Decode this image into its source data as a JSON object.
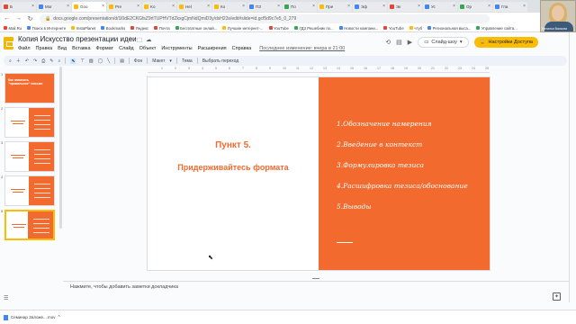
{
  "browser": {
    "tabs": [
      {
        "label": "Б",
        "color": "red",
        "active": false
      },
      {
        "label": "Mor",
        "color": "blue",
        "active": false
      },
      {
        "label": "Goo",
        "color": "yellow",
        "active": true
      },
      {
        "label": "Pre",
        "color": "yellow",
        "active": false
      },
      {
        "label": "Ko",
        "color": "yellow",
        "active": false
      },
      {
        "label": "Hel",
        "color": "yellow",
        "active": false
      },
      {
        "label": "Ко",
        "color": "yellow",
        "active": false
      },
      {
        "label": "ПЗ",
        "color": "blue",
        "active": false
      },
      {
        "label": "По",
        "color": "green",
        "active": false
      },
      {
        "label": "Пре",
        "color": "yellow",
        "active": false
      },
      {
        "label": "Эф",
        "color": "blue",
        "active": false
      },
      {
        "label": "Эк",
        "color": "red",
        "active": false
      },
      {
        "label": "Ус",
        "color": "blue",
        "active": false
      },
      {
        "label": "Ор",
        "color": "green",
        "active": false
      },
      {
        "label": "Гла",
        "color": "blue",
        "active": false
      }
    ],
    "url": "docs.google.com/presentation/d/1l0dE2CKGfsZ9rtTUPHVTdZkxgCjmNdQmiD3y/dsH23s/edit#slide=id.gcf5d9c7e5_0_279",
    "bookmarks": [
      {
        "label": "Mail.Ru",
        "color": "r"
      },
      {
        "label": "Поиск в Интернете",
        "color": "b"
      },
      {
        "label": "InstaPlanet",
        "color": "y"
      },
      {
        "label": "Bookmarks",
        "color": "b"
      },
      {
        "label": "Яндекс",
        "color": "r"
      },
      {
        "label": "Почта",
        "color": "r"
      },
      {
        "label": "Бесплатные онлай...",
        "color": "g"
      },
      {
        "label": "Лучшие интернет-...",
        "color": "y"
      },
      {
        "label": "YouTube",
        "color": "r"
      },
      {
        "label": "ГДЗ Решебник по...",
        "color": "g"
      },
      {
        "label": "Новости компани...",
        "color": "b"
      },
      {
        "label": "YouTube",
        "color": "r"
      },
      {
        "label": "чтуб",
        "color": "y"
      },
      {
        "label": "Региональная выса...",
        "color": "b"
      },
      {
        "label": "Управление сайта...",
        "color": "g"
      }
    ]
  },
  "app": {
    "title": "Копия Искусство презентации идеи",
    "menu": [
      "Файл",
      "Правка",
      "Вид",
      "Вставка",
      "Формат",
      "Слайд",
      "Объект",
      "Инструменты",
      "Расширения",
      "Справка"
    ],
    "last_edit": "Последнее изменение: вчера в 21:00",
    "slideshow_label": "Слайд-шоу",
    "share_label": "Настройки Доступа",
    "webcam_name": "Наталья Васкова"
  },
  "toolbar": {
    "background_label": "Фон",
    "layout_label": "Макет",
    "theme_label": "Тема",
    "transition_label": "Выбрать переход"
  },
  "filmstrip": {
    "thumbnails": [
      {
        "number": "1",
        "title": "Как написать \"правильное\" письмо",
        "style": "full"
      },
      {
        "number": "2",
        "title": "",
        "style": "split"
      },
      {
        "number": "3",
        "title": "",
        "style": "split"
      },
      {
        "number": "4",
        "title": "",
        "style": "split"
      },
      {
        "number": "5",
        "title": "",
        "style": "split",
        "selected": true
      }
    ]
  },
  "slide": {
    "heading_line1": "Пункт 5.",
    "heading_line2": "Придерживайтесь формата",
    "points": [
      "1.Обозначение намерения",
      "2.Введение в контекст",
      "3.Формулировка тезиса",
      "4.Расшифровка тезиса/обоснование",
      "5.Выводы"
    ]
  },
  "notes": {
    "placeholder": "Нажмите, чтобы добавить заметки докладчика"
  },
  "downloads": {
    "file_label": "Семинар Заложе....mov"
  },
  "colors": {
    "accent_orange": "#f26a2e",
    "share_yellow": "#fbbc04",
    "toolbar_bg": "#edf2fa"
  },
  "icons": {
    "star": "star-icon",
    "move": "folder-move-icon",
    "cloud": "cloud-status-icon",
    "history": "history-icon",
    "comment": "comment-icon",
    "meet": "meet-icon"
  }
}
